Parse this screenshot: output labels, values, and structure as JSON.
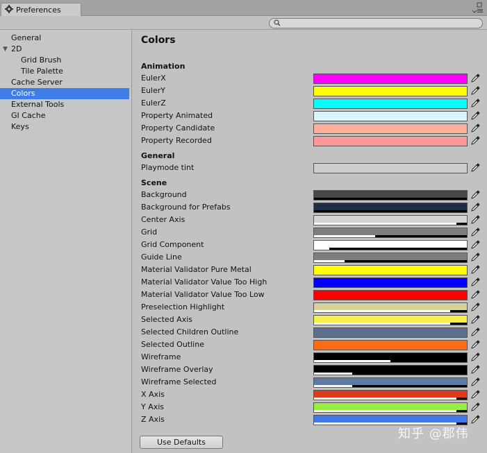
{
  "window": {
    "title": "Preferences",
    "icon": "gear-icon"
  },
  "search": {
    "placeholder": ""
  },
  "sidebar": {
    "items": [
      {
        "label": "General",
        "indent": 0,
        "selected": false
      },
      {
        "label": "2D",
        "indent": 0,
        "selected": false,
        "expandable": true,
        "expanded": true
      },
      {
        "label": "Grid Brush",
        "indent": 2,
        "selected": false
      },
      {
        "label": "Tile Palette",
        "indent": 2,
        "selected": false
      },
      {
        "label": "Cache Server",
        "indent": 0,
        "selected": false
      },
      {
        "label": "Colors",
        "indent": 0,
        "selected": true
      },
      {
        "label": "External Tools",
        "indent": 0,
        "selected": false
      },
      {
        "label": "GI Cache",
        "indent": 0,
        "selected": false
      },
      {
        "label": "Keys",
        "indent": 0,
        "selected": false
      }
    ]
  },
  "main": {
    "title": "Colors",
    "sections": [
      {
        "title": "Animation",
        "rows": [
          {
            "label": "EulerX",
            "color": "#ff00ff",
            "alpha": 1.0
          },
          {
            "label": "EulerY",
            "color": "#ffff00",
            "alpha": 1.0
          },
          {
            "label": "EulerZ",
            "color": "#00ffff",
            "alpha": 1.0
          },
          {
            "label": "Property Animated",
            "color": "#d8f5fb",
            "alpha": 1.0
          },
          {
            "label": "Property Candidate",
            "color": "#ffb09a",
            "alpha": 1.0
          },
          {
            "label": "Property Recorded",
            "color": "#ff9898",
            "alpha": 1.0
          }
        ]
      },
      {
        "title": "General",
        "rows": [
          {
            "label": "Playmode tint",
            "color": "#cccccc",
            "alpha": 1.0
          }
        ]
      },
      {
        "title": "Scene",
        "rows": [
          {
            "label": "Background",
            "color": "#474747",
            "alpha": 0.0
          },
          {
            "label": "Background for Prefabs",
            "color": "#1e2e44",
            "alpha": 0.0
          },
          {
            "label": "Center Axis",
            "color": "#d2d2d2",
            "alpha": 0.93
          },
          {
            "label": "Grid",
            "color": "#7d7d7d",
            "alpha": 0.4
          },
          {
            "label": "Grid Component",
            "color": "#ffffff",
            "alpha": 0.1
          },
          {
            "label": "Guide Line",
            "color": "#7d7d7d",
            "alpha": 0.2
          },
          {
            "label": "Material Validator Pure Metal",
            "color": "#ffff00",
            "alpha": 1.0
          },
          {
            "label": "Material Validator Value Too High",
            "color": "#0000ff",
            "alpha": 1.0
          },
          {
            "label": "Material Validator Value Too Low",
            "color": "#ff0000",
            "alpha": 1.0
          },
          {
            "label": "Preselection Highlight",
            "color": "#d6d29c",
            "alpha": 0.89
          },
          {
            "label": "Selected Axis",
            "color": "#f6ef4a",
            "alpha": 0.89
          },
          {
            "label": "Selected Children Outline",
            "color": "#5b6f8f",
            "alpha": 1.0
          },
          {
            "label": "Selected Outline",
            "color": "#ff6a14",
            "alpha": 1.0
          },
          {
            "label": "Wireframe",
            "color": "#000000",
            "alpha": 0.5
          },
          {
            "label": "Wireframe Overlay",
            "color": "#000000",
            "alpha": 0.25
          },
          {
            "label": "Wireframe Selected",
            "color": "#5e7aa4",
            "alpha": 0.25
          },
          {
            "label": "X Axis",
            "color": "#dc3b1d",
            "alpha": 0.93
          },
          {
            "label": "Y Axis",
            "color": "#99ee44",
            "alpha": 0.93
          },
          {
            "label": "Z Axis",
            "color": "#3e78ec",
            "alpha": 0.93
          }
        ]
      }
    ],
    "use_defaults_label": "Use Defaults"
  },
  "watermark": "知乎 @郡伟"
}
